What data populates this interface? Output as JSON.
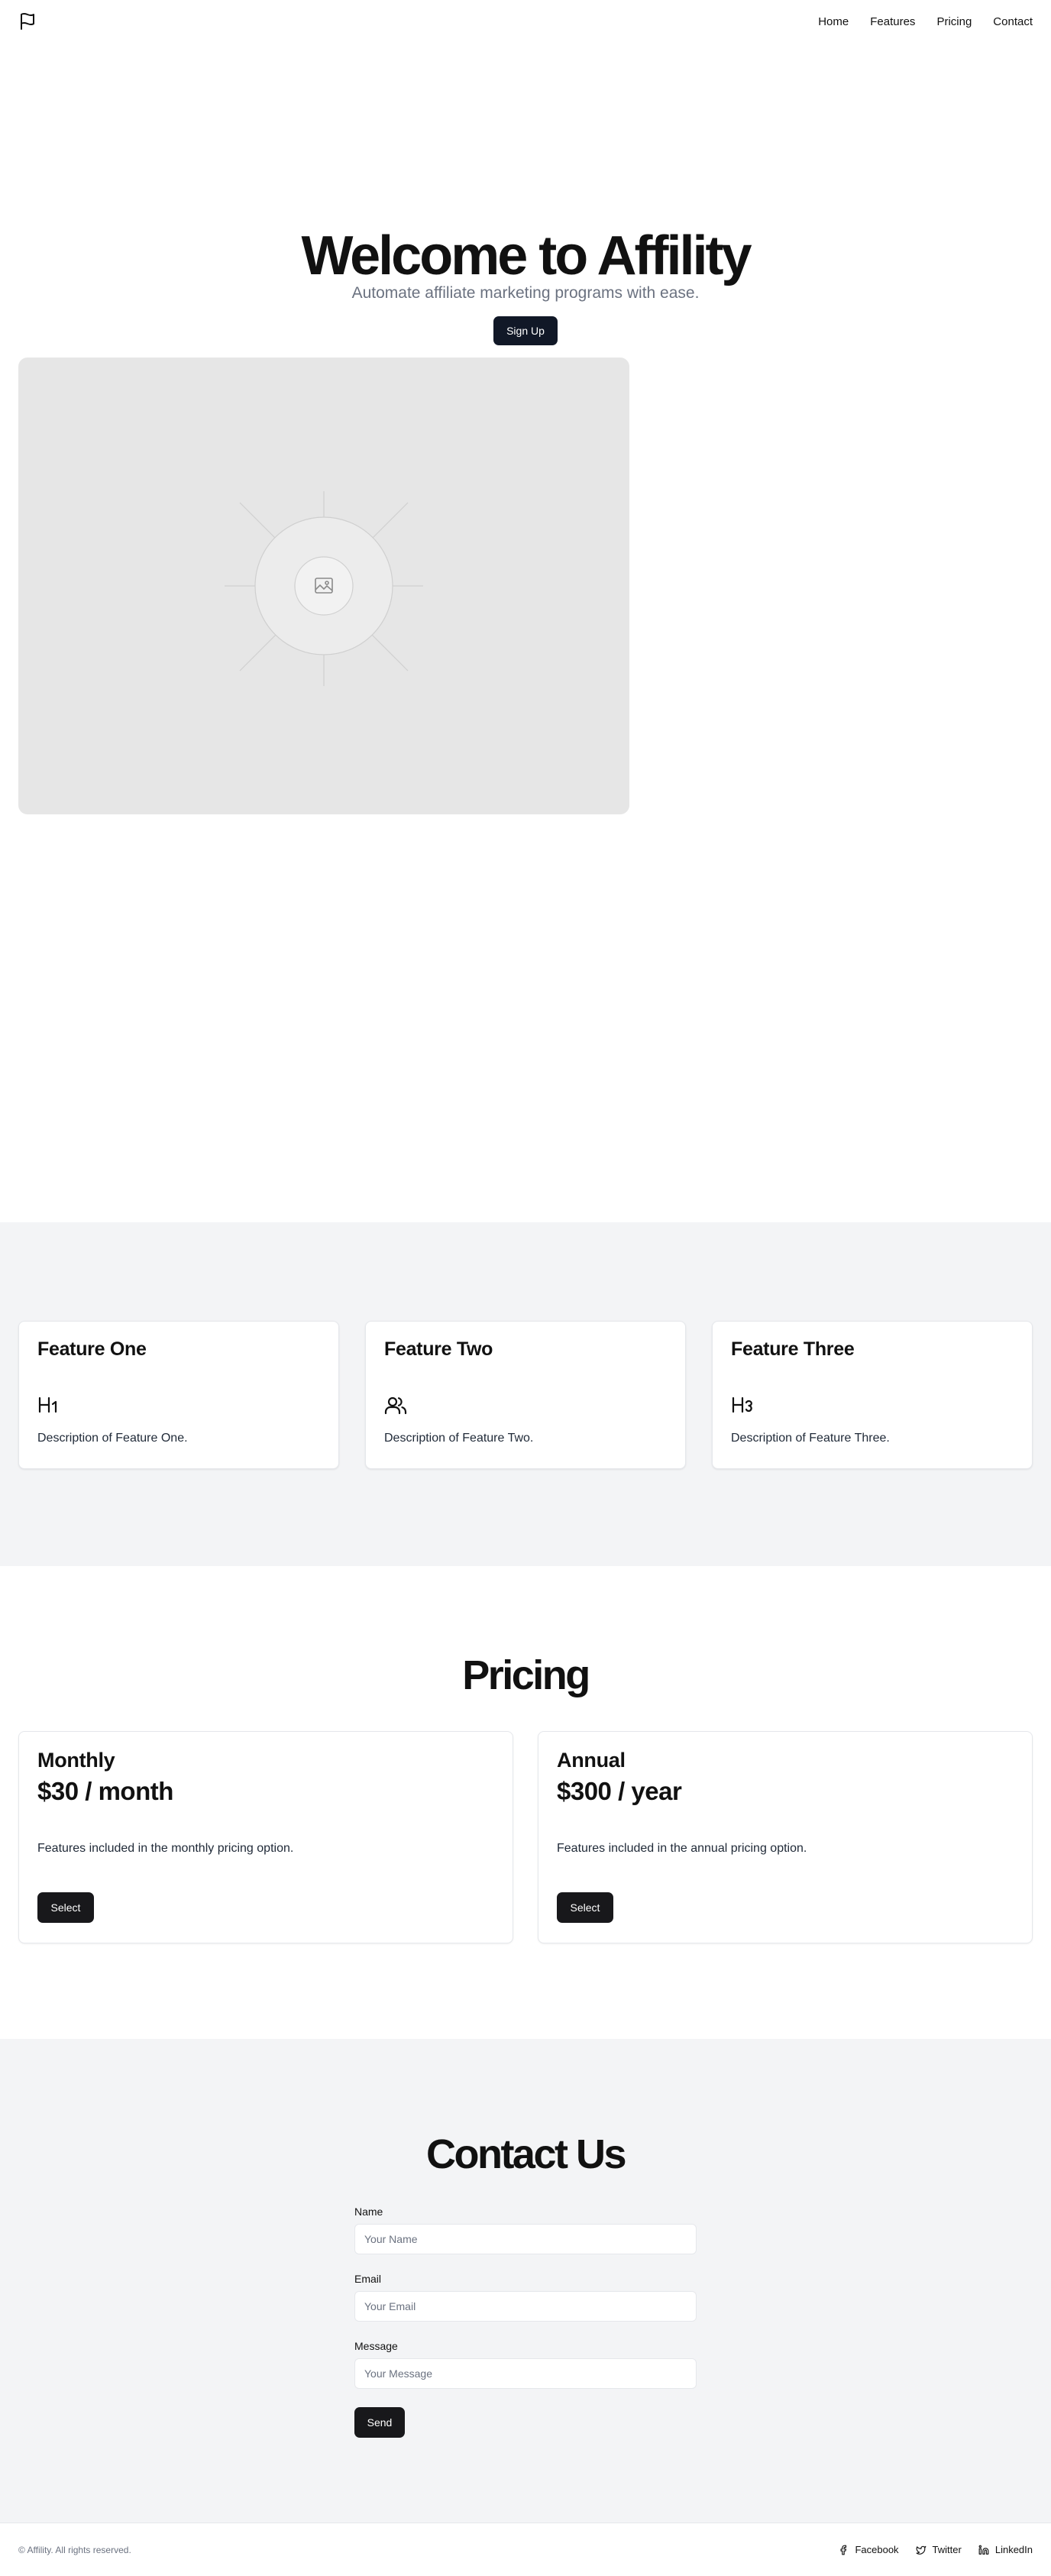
{
  "header": {
    "nav": [
      "Home",
      "Features",
      "Pricing",
      "Contact"
    ]
  },
  "hero": {
    "title": "Welcome to Affility",
    "subtitle": "Automate affiliate marketing programs with ease.",
    "cta": "Sign Up"
  },
  "features": [
    {
      "title": "Feature One",
      "icon": "heading-1-icon",
      "description": "Description of Feature One."
    },
    {
      "title": "Feature Two",
      "icon": "users-icon",
      "description": "Description of Feature Two."
    },
    {
      "title": "Feature Three",
      "icon": "heading-3-icon",
      "description": "Description of Feature Three."
    }
  ],
  "pricing": {
    "title": "Pricing",
    "plans": [
      {
        "name": "Monthly",
        "price": "$30 / month",
        "description": "Features included in the monthly pricing option.",
        "button": "Select"
      },
      {
        "name": "Annual",
        "price": "$300 / year",
        "description": "Features included in the annual pricing option.",
        "button": "Select"
      }
    ]
  },
  "contact": {
    "title": "Contact Us",
    "fields": [
      {
        "label": "Name",
        "placeholder": "Your Name"
      },
      {
        "label": "Email",
        "placeholder": "Your Email"
      },
      {
        "label": "Message",
        "placeholder": "Your Message"
      }
    ],
    "submit": "Send"
  },
  "footer": {
    "copyright": "© Affility. All rights reserved.",
    "social": [
      "Facebook",
      "Twitter",
      "LinkedIn"
    ]
  },
  "colors": {
    "button": "#111827",
    "section_bg": "#f3f4f6",
    "muted_text": "#6b7280"
  }
}
